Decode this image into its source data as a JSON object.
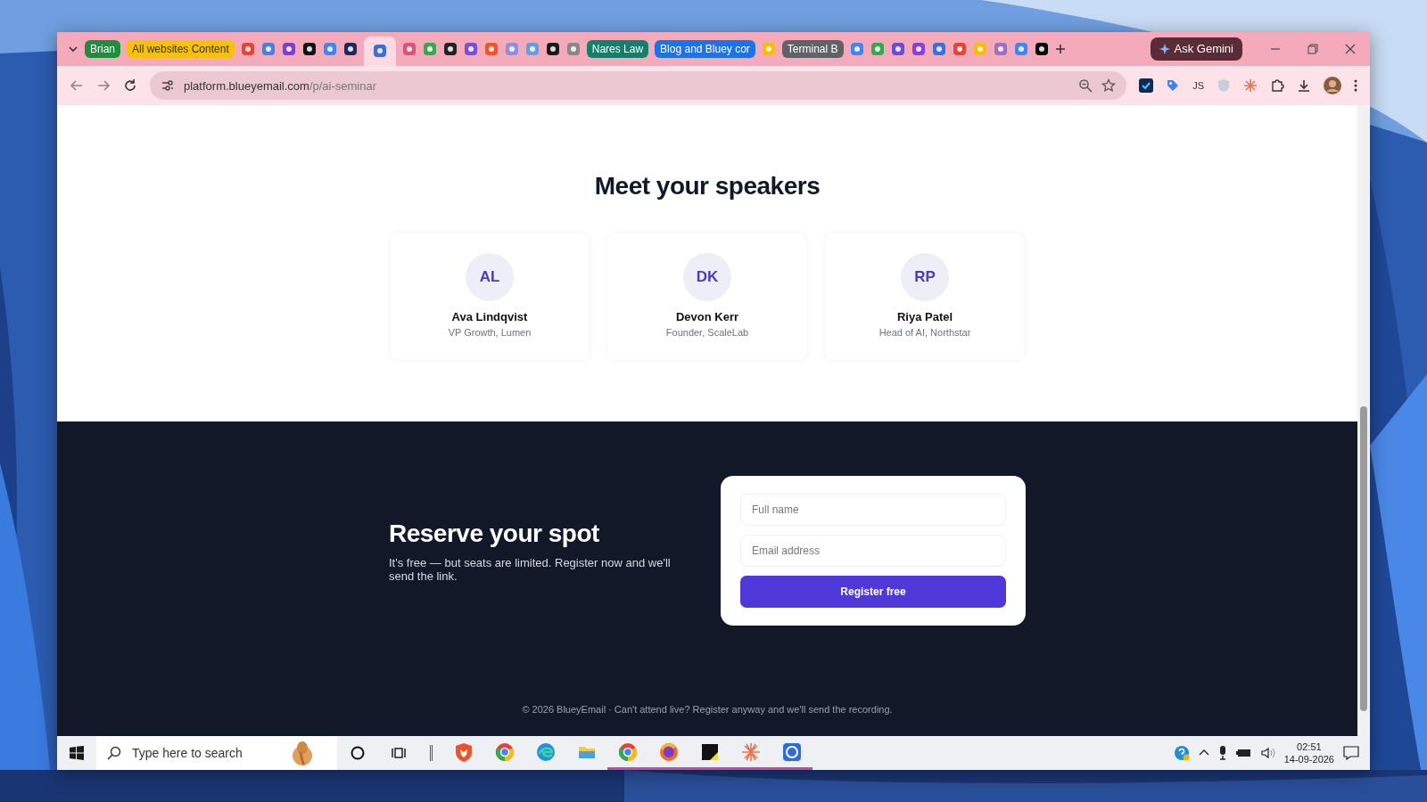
{
  "window": {
    "tabs": [
      {
        "kind": "group",
        "label": "Brian",
        "color": "#1e8e3e",
        "selected": false
      },
      {
        "kind": "group",
        "label": "All websites Content",
        "color": "#f9c200",
        "selected": false
      },
      {
        "kind": "favicon",
        "color": "#ea4335",
        "selected": false
      },
      {
        "kind": "favicon",
        "color": "#4a7fe0",
        "selected": false
      },
      {
        "kind": "favicon",
        "color": "#7b3fd1",
        "selected": false
      },
      {
        "kind": "favicon",
        "color": "#111111",
        "selected": false
      },
      {
        "kind": "favicon",
        "color": "#4285f4",
        "selected": false
      },
      {
        "kind": "favicon",
        "color": "#1b2a5a",
        "selected": false
      },
      {
        "kind": "favicon",
        "color": "#3b6fe0",
        "selected": true
      },
      {
        "kind": "favicon",
        "color": "#e0507a",
        "selected": false
      },
      {
        "kind": "favicon",
        "color": "#34a853",
        "selected": false
      },
      {
        "kind": "favicon",
        "color": "#222222",
        "selected": false
      },
      {
        "kind": "favicon",
        "color": "#7a4fd8",
        "selected": false
      },
      {
        "kind": "favicon",
        "color": "#f0552a",
        "selected": false
      },
      {
        "kind": "favicon",
        "color": "#8f8fe0",
        "selected": false
      },
      {
        "kind": "favicon",
        "color": "#6a9be0",
        "selected": false
      },
      {
        "kind": "favicon",
        "color": "#1a1a1a",
        "selected": false
      },
      {
        "kind": "favicon",
        "color": "#888888",
        "selected": false
      },
      {
        "kind": "group",
        "label": "Nares Law",
        "color": "#13806e",
        "selected": false
      },
      {
        "kind": "group",
        "label": "Blog and Bluey cor",
        "color": "#1a73e8",
        "selected": false
      },
      {
        "kind": "favicon",
        "color": "#fbbc05",
        "selected": false
      },
      {
        "kind": "group",
        "label": "Terminal B",
        "color": "#5f6368",
        "selected": false
      },
      {
        "kind": "favicon",
        "color": "#4285f4",
        "selected": false
      },
      {
        "kind": "favicon",
        "color": "#34a853",
        "selected": false
      },
      {
        "kind": "favicon",
        "color": "#6c4bd6",
        "selected": false
      },
      {
        "kind": "favicon",
        "color": "#8a3ee0",
        "selected": false
      },
      {
        "kind": "favicon",
        "color": "#3a6fe0",
        "selected": false
      },
      {
        "kind": "favicon",
        "color": "#ea4335",
        "selected": false
      },
      {
        "kind": "favicon",
        "color": "#fbbc05",
        "selected": false
      },
      {
        "kind": "favicon",
        "color": "#a070c0",
        "selected": false
      },
      {
        "kind": "favicon",
        "color": "#4285f4",
        "selected": false
      },
      {
        "kind": "favicon",
        "color": "#000000",
        "selected": false
      }
    ],
    "ask_button": "Ask Gemini"
  },
  "address_bar": {
    "host": "platform.blueyemail.com",
    "path": "/p/ai-seminar"
  },
  "extensions_label": "JS",
  "speakers_section": {
    "heading": "Meet your speakers",
    "speakers": [
      {
        "initials": "AL",
        "name": "Ava Lindqvist",
        "role": "VP Growth, Lumen"
      },
      {
        "initials": "DK",
        "name": "Devon Kerr",
        "role": "Founder, ScaleLab"
      },
      {
        "initials": "RP",
        "name": "Riya Patel",
        "role": "Head of AI, Northstar"
      }
    ]
  },
  "register_section": {
    "heading": "Reserve your spot",
    "text": "It's free — but seats are limited. Register now and we'll send the link.",
    "fields": [
      {
        "placeholder": "Full name"
      },
      {
        "placeholder": "Email address"
      }
    ],
    "button": "Register free"
  },
  "footer": "© 2026 BlueyEmail · Can't attend live? Register anyway and we'll send the recording.",
  "taskbar": {
    "search": {
      "placeholder": "Type here to search"
    },
    "apps": [
      {
        "kind": "shield",
        "running": false
      },
      {
        "kind": "ring",
        "running": false
      },
      {
        "kind": "wave",
        "running": false
      },
      {
        "kind": "folder",
        "running": false
      },
      {
        "kind": "ring",
        "running": true
      },
      {
        "kind": "globe",
        "running": true
      },
      {
        "kind": "note",
        "running": true
      },
      {
        "kind": "burst",
        "running": true
      },
      {
        "kind": "circle",
        "running": true
      }
    ],
    "time": "02:51",
    "date": "14-09-2026"
  }
}
